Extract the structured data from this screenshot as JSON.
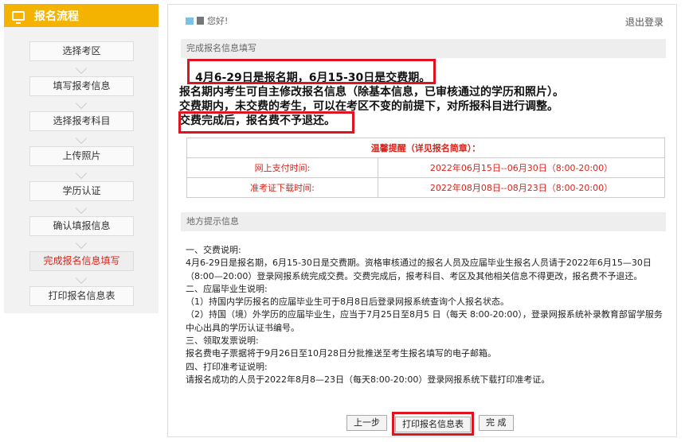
{
  "sidebar": {
    "title": "报名流程",
    "steps": [
      "选择考区",
      "填写报考信息",
      "选择报考科目",
      "上传照片",
      "学历认证",
      "确认填报信息",
      "完成报名信息填写",
      "打印报名信息表"
    ],
    "active_index": 6
  },
  "header": {
    "greeting": "您好!",
    "logout": "退出登录"
  },
  "section1": {
    "title": "完成报名信息填写"
  },
  "notice": {
    "line1": "4月6-29日是报名期，6月15-30日是交费期。",
    "line2": "报名期内考生可自主修改报名信息（除基本信息，已审核通过的学历和照片）。",
    "line3": "交费期内，未交费的考生，可以在考区不变的前提下，对所报科目进行调整。",
    "line4": "交费完成后，报名费不予退还。"
  },
  "table": {
    "title": "温馨提醒（详见报名简章）：",
    "rows": [
      {
        "label": "网上支付时间:",
        "value": "2022年06月15日--06月30日（8:00-20:00）"
      },
      {
        "label": "准考证下载时间:",
        "value": "2022年08月08日--08月23日（8:00-20:00）"
      }
    ]
  },
  "section2": {
    "title": "地方提示信息"
  },
  "body": {
    "lines": [
      "一、交费说明:",
      "4月6-29日是报名期，6月15-30日是交费期。资格审核通过的报名人员及应届毕业生报名人员请于2022年6月15—30日（8:00—20:00）登录网报系统完成交费。交费完成后，报考科目、考区及其他相关信息不得更改，报名费不予退还。",
      "二、应届毕业生说明:",
      "（1）持国内学历报名的应届毕业生可于8月8日后登录网报系统查询个人报名状态。",
      "（2）持国（境）外学历的应届毕业生，应当于7月25日至8月5 日（每天 8:00-20:00），登录网报系统补录教育部留学服务中心出具的学历认证书编号。",
      "三、领取发票说明:",
      "报名费电子票据将于9月26日至10月28日分批推送至考生报名填写的电子邮箱。",
      "四、打印准考证说明:",
      "请报名成功的人员于2022年8月8—23日（每天8:00-20:00）登录网报系统下载打印准考证。"
    ]
  },
  "buttons": {
    "prev": "上一步",
    "print": "打印报名信息表",
    "done": "完 成"
  }
}
